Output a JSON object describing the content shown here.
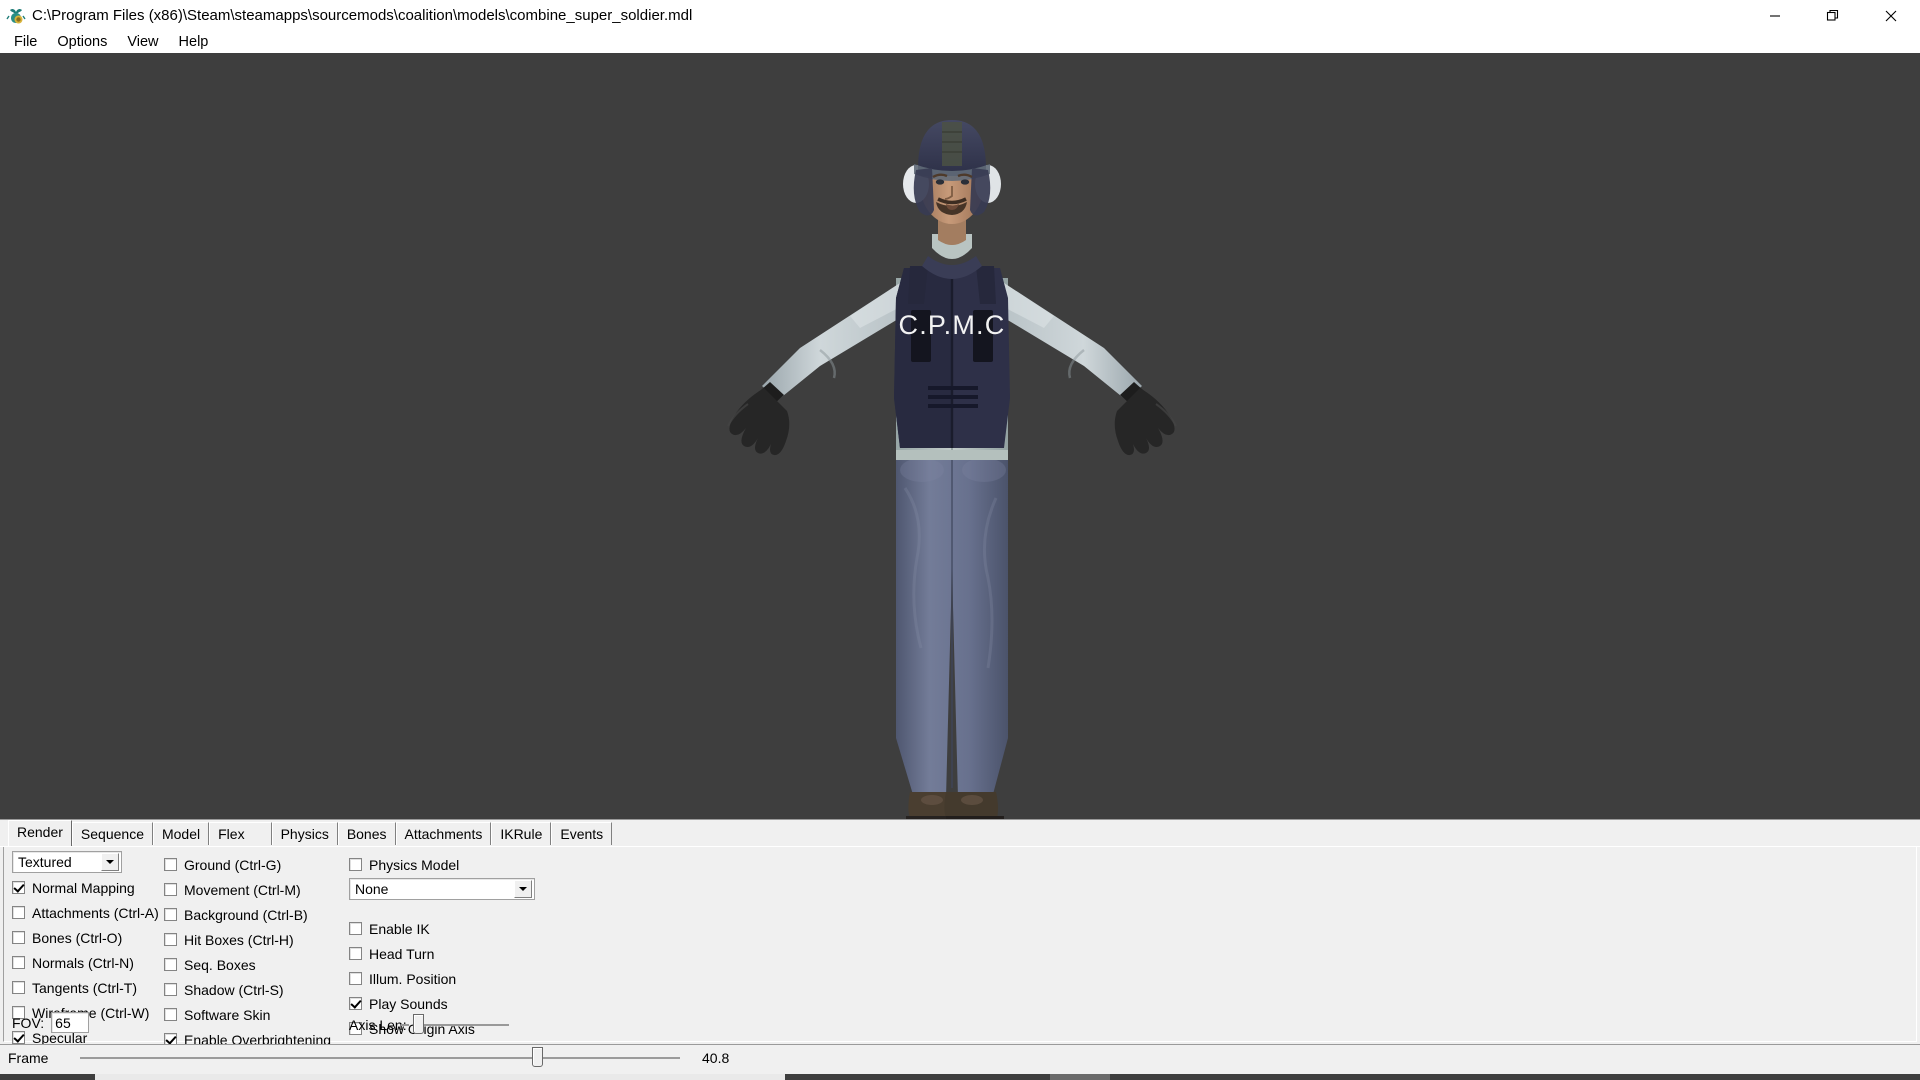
{
  "window": {
    "title": "C:\\Program Files (x86)\\Steam\\steamapps\\sourcemods\\coalition\\models\\combine_super_soldier.mdl",
    "icon": "hlmv-crab-icon",
    "controls": {
      "minimize": "minimize-icon",
      "restore": "restore-icon",
      "close": "close-icon"
    }
  },
  "menubar": {
    "items": [
      {
        "label": "File"
      },
      {
        "label": "Options"
      },
      {
        "label": "View"
      },
      {
        "label": "Help"
      }
    ]
  },
  "viewport": {
    "background_color": "#3e3e3e",
    "model_name": "combine_super_soldier",
    "vest_text": "C.P.M.C",
    "colors": {
      "helmet": "#3a3c52",
      "vest": "#2e3048",
      "sleeve": "#c9d2d6",
      "jeans": "#67708c",
      "boots": "#4a3d31",
      "glove": "#2a2a2a",
      "skin": "#b98f73"
    }
  },
  "tabs": [
    {
      "label": "Render",
      "active": true
    },
    {
      "label": "Sequence",
      "active": false
    },
    {
      "label": "Model",
      "active": false
    },
    {
      "label": "Flex",
      "active": false
    },
    {
      "label": "Physics",
      "active": false
    },
    {
      "label": "Bones",
      "active": false
    },
    {
      "label": "Attachments",
      "active": false
    },
    {
      "label": "IKRule",
      "active": false
    },
    {
      "label": "Events",
      "active": false
    }
  ],
  "render_panel": {
    "render_mode": {
      "value": "Textured",
      "icon": "chevron-down-icon"
    },
    "column1": [
      {
        "label": "Normal Mapping",
        "checked": true
      },
      {
        "label": "Attachments (Ctrl-A)",
        "checked": false
      },
      {
        "label": "Bones (Ctrl-O)",
        "checked": false
      },
      {
        "label": "Normals (Ctrl-N)",
        "checked": false
      },
      {
        "label": "Tangents (Ctrl-T)",
        "checked": false
      },
      {
        "label": "Wireframe (Ctrl-W)",
        "checked": false
      },
      {
        "label": "Specular",
        "checked": true
      }
    ],
    "column2": [
      {
        "label": "Ground (Ctrl-G)",
        "checked": false
      },
      {
        "label": "Movement (Ctrl-M)",
        "checked": false
      },
      {
        "label": "Background (Ctrl-B)",
        "checked": false
      },
      {
        "label": "Hit Boxes (Ctrl-H)",
        "checked": false
      },
      {
        "label": "Seq. Boxes",
        "checked": false
      },
      {
        "label": "Shadow (Ctrl-S)",
        "checked": false
      },
      {
        "label": "Software Skin",
        "checked": false
      },
      {
        "label": "Enable Overbrightening",
        "checked": true
      }
    ],
    "column3": [
      {
        "label": "Physics Model",
        "checked": false
      }
    ],
    "physics_combo": {
      "value": "None",
      "icon": "chevron-down-icon"
    },
    "column3b": [
      {
        "label": "Enable IK",
        "checked": false
      },
      {
        "label": "Head Turn",
        "checked": false
      },
      {
        "label": "Illum. Position",
        "checked": false
      },
      {
        "label": "Play Sounds",
        "checked": true
      },
      {
        "label": "Show Origin Axis",
        "checked": false
      }
    ],
    "fov": {
      "label": "FOV:",
      "value": "65"
    },
    "axis_len": {
      "label": "Axis Len:",
      "value": 4
    }
  },
  "frame_bar": {
    "label": "Frame",
    "value": "40.8",
    "position_percent": 75
  }
}
